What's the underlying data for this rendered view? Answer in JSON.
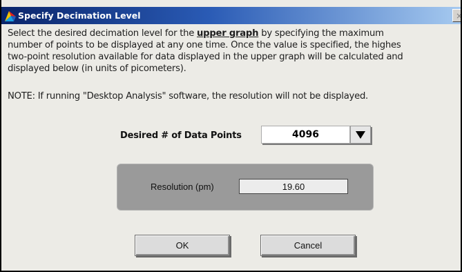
{
  "window": {
    "title": "Specify Decimation Level",
    "close_glyph": "×"
  },
  "description": {
    "line1_before": "Select the desired decimation level for the ",
    "line1_emph": "upper graph",
    "line1_after": "  by specifying the maximum",
    "line2": "number of points to be displayed at any one time.  Once the value is specified, the highes",
    "line3": "two-point resolution available for data displayed in the upper graph will be calculated and",
    "line4": "displayed below (in units of picometers)."
  },
  "note": "NOTE:  If running \"Desktop Analysis\" software, the resolution will not be displayed.",
  "data_points": {
    "label": "Desired # of Data Points",
    "value": "4096"
  },
  "resolution": {
    "label": "Resolution (pm)",
    "value": "19.60"
  },
  "buttons": {
    "ok": "OK",
    "cancel": "Cancel"
  },
  "icons": {
    "app": "labview-app-icon",
    "close": "close-icon",
    "dropdown": "dropdown-arrow-icon"
  }
}
